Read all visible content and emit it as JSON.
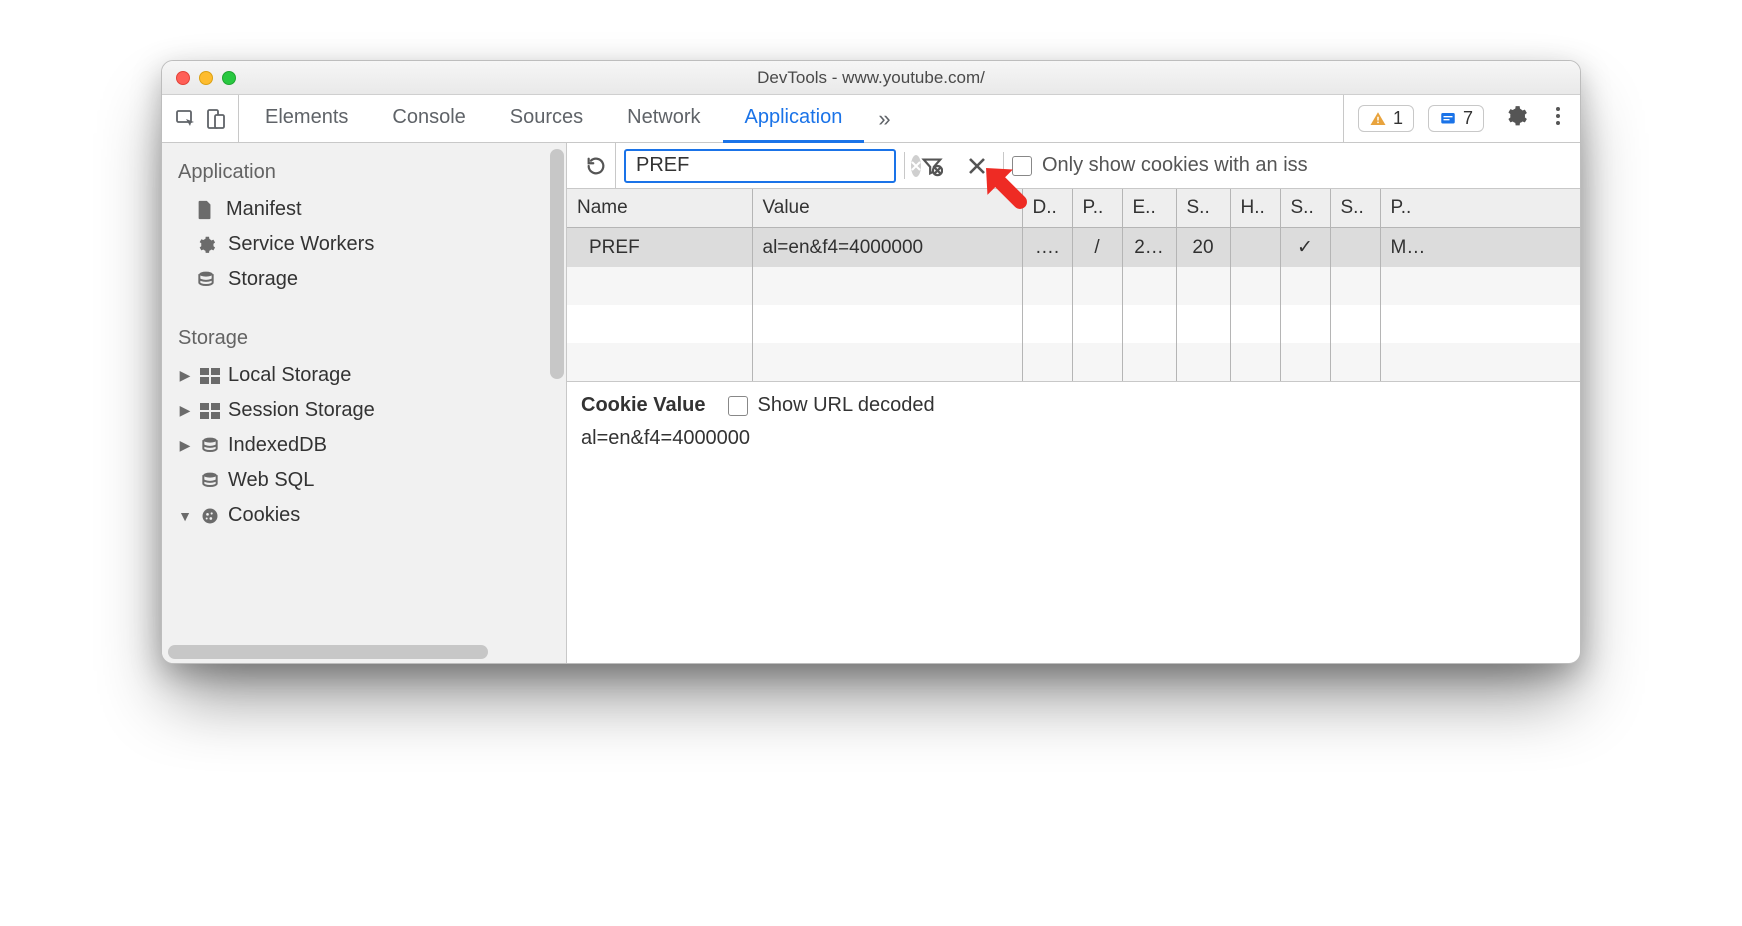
{
  "window": {
    "title": "DevTools - www.youtube.com/"
  },
  "toolbar": {
    "tabs": [
      "Elements",
      "Console",
      "Sources",
      "Network",
      "Application"
    ],
    "active_tab": "Application",
    "warnings": "1",
    "issues": "7"
  },
  "sidebar": {
    "sections": {
      "application": {
        "label": "Application",
        "items": [
          {
            "icon": "file",
            "label": "Manifest"
          },
          {
            "icon": "gear",
            "label": "Service Workers"
          },
          {
            "icon": "db",
            "label": "Storage"
          }
        ]
      },
      "storage": {
        "label": "Storage",
        "items": [
          {
            "icon": "grid",
            "label": "Local Storage",
            "caret": "right"
          },
          {
            "icon": "grid",
            "label": "Session Storage",
            "caret": "right"
          },
          {
            "icon": "db",
            "label": "IndexedDB",
            "caret": "right"
          },
          {
            "icon": "db",
            "label": "Web SQL",
            "caret": "none"
          },
          {
            "icon": "cookie",
            "label": "Cookies",
            "caret": "down"
          }
        ]
      }
    }
  },
  "filter": {
    "value": "PREF",
    "only_issues_label": "Only show cookies with an iss"
  },
  "table": {
    "headers": [
      "Name",
      "Value",
      "D..",
      "P..",
      "E..",
      "S..",
      "H..",
      "S..",
      "S..",
      "P.."
    ],
    "rows": [
      {
        "cells": [
          "PREF",
          "al=en&f4=4000000",
          "….",
          "/",
          "2…",
          "20",
          "",
          "✓",
          "",
          "M…"
        ],
        "selected": true
      }
    ]
  },
  "detail": {
    "title": "Cookie Value",
    "show_decoded_label": "Show URL decoded",
    "value": "al=en&f4=4000000"
  }
}
